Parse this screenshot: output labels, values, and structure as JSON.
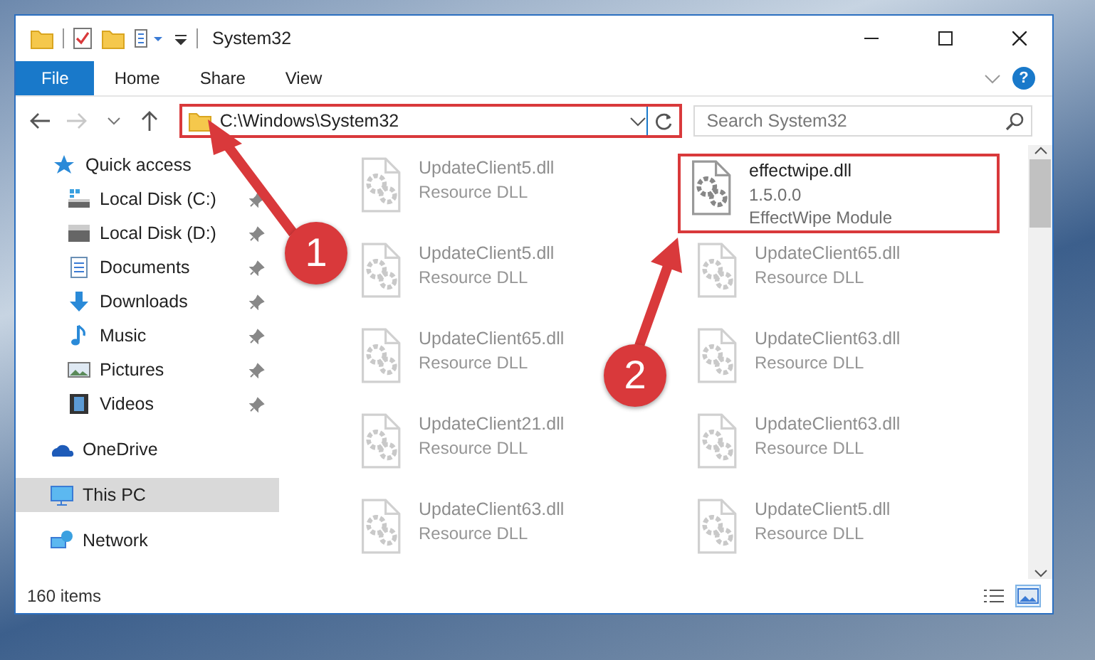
{
  "window": {
    "title": "System32"
  },
  "ribbon": {
    "tabs": [
      {
        "label": "File",
        "selected": true
      },
      {
        "label": "Home",
        "selected": false
      },
      {
        "label": "Share",
        "selected": false
      },
      {
        "label": "View",
        "selected": false
      }
    ],
    "help": "?"
  },
  "address_bar": {
    "path": "C:\\Windows\\System32",
    "highlighted": true,
    "forward_disabled": true
  },
  "search": {
    "placeholder": "Search System32"
  },
  "sidebar": {
    "items": [
      {
        "label": "Quick access",
        "kind": "star",
        "selected": false,
        "children": [
          {
            "label": "Local Disk (C:)",
            "kind": "system-drive",
            "pinned": true,
            "selected": false
          },
          {
            "label": "Local Disk (D:)",
            "kind": "drive",
            "pinned": true,
            "selected": false
          },
          {
            "label": "Documents",
            "kind": "document",
            "pinned": true,
            "selected": false
          },
          {
            "label": "Downloads",
            "kind": "download",
            "pinned": true,
            "selected": false
          },
          {
            "label": "Music",
            "kind": "music",
            "pinned": true,
            "selected": false
          },
          {
            "label": "Pictures",
            "kind": "picture",
            "pinned": true,
            "selected": false
          },
          {
            "label": "Videos",
            "kind": "video",
            "pinned": true,
            "selected": false
          }
        ]
      },
      {
        "label": "OneDrive",
        "kind": "cloud",
        "selected": false
      },
      {
        "label": "This PC",
        "kind": "computer",
        "selected": true
      },
      {
        "label": "Network",
        "kind": "network",
        "selected": false
      }
    ]
  },
  "files": [
    {
      "name": "UpdateClient5.dll",
      "lines": [
        "Resource DLL"
      ],
      "faded": true,
      "highlighted": false
    },
    {
      "name": "effectwipe.dll",
      "lines": [
        "1.5.0.0",
        "EffectWipe Module"
      ],
      "faded": false,
      "highlighted": true
    },
    {
      "name": "UpdateClient5.dll",
      "lines": [
        "Resource DLL"
      ],
      "faded": true,
      "highlighted": false
    },
    {
      "name": "UpdateClient65.dll",
      "lines": [
        "Resource DLL"
      ],
      "faded": true,
      "highlighted": false
    },
    {
      "name": "UpdateClient65.dll",
      "lines": [
        "Resource DLL"
      ],
      "faded": true,
      "highlighted": false
    },
    {
      "name": "UpdateClient63.dll",
      "lines": [
        "Resource DLL"
      ],
      "faded": true,
      "highlighted": false
    },
    {
      "name": "UpdateClient21.dll",
      "lines": [
        "Resource DLL"
      ],
      "faded": true,
      "highlighted": false
    },
    {
      "name": "UpdateClient63.dll",
      "lines": [
        "Resource DLL"
      ],
      "faded": true,
      "highlighted": false
    },
    {
      "name": "UpdateClient63.dll",
      "lines": [
        "Resource DLL"
      ],
      "faded": true,
      "highlighted": false
    },
    {
      "name": "UpdateClient5.dll",
      "lines": [
        "Resource DLL"
      ],
      "faded": true,
      "highlighted": false
    }
  ],
  "status_bar": {
    "count": "160 items",
    "views": [
      {
        "kind": "details",
        "selected": false
      },
      {
        "kind": "large-icons",
        "selected": true
      }
    ]
  },
  "callouts": [
    {
      "label": "1"
    },
    {
      "label": "2"
    }
  ]
}
